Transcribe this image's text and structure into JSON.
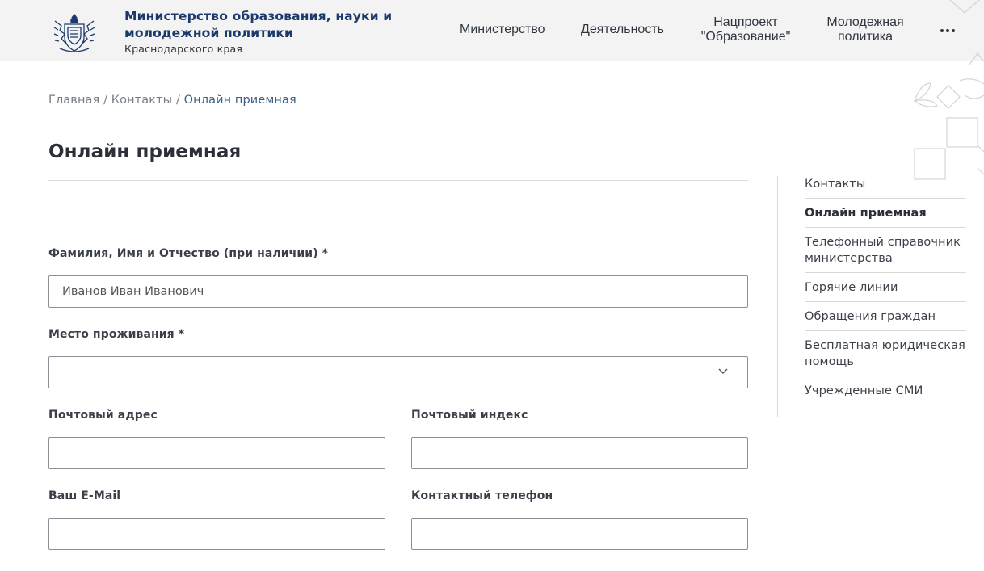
{
  "header": {
    "brand_line1": "Министерство образования, науки и",
    "brand_line2": "молодежной политики",
    "brand_sub": "Краснодарского края",
    "nav": [
      {
        "line1": "Министерство",
        "line2": ""
      },
      {
        "line1": "Деятельность",
        "line2": ""
      },
      {
        "line1": "Нацпроект",
        "line2": "\"Образование\""
      },
      {
        "line1": "Молодежная",
        "line2": "политика"
      }
    ],
    "more_icon": "ellipsis-icon"
  },
  "breadcrumb": {
    "home": "Главная",
    "sep": "/",
    "contacts": "Контакты",
    "current": "Онлайн приемная"
  },
  "page_title": "Онлайн приемная",
  "form": {
    "fio_label": "Фамилия, Имя и Отчество (при наличии) *",
    "fio_value": "Иванов Иван Иванович",
    "residence_label": "Место проживания *",
    "residence_value": "",
    "postal_address_label": "Почтовый адрес",
    "postal_address_value": "",
    "postal_index_label": "Почтовый индекс",
    "postal_index_value": "",
    "email_label": "Ваш E-Mail",
    "email_value": "",
    "phone_label": "Контактный телефон",
    "phone_value": ""
  },
  "side_menu": {
    "items": [
      {
        "label": "Контакты"
      },
      {
        "label": "Онлайн приемная"
      },
      {
        "label": "Телефонный справочник министерства"
      },
      {
        "label": "Горячие линии"
      },
      {
        "label": "Обращения граждан"
      },
      {
        "label": "Бесплатная юридическая помощь"
      },
      {
        "label": "Учрежденные СМИ"
      }
    ],
    "active_index": 1
  },
  "colors": {
    "brand": "#1b3a6b",
    "header_bg": "#f3f3f3",
    "breadcrumb_current": "#3b5f87",
    "field_border": "#8a8f96"
  }
}
